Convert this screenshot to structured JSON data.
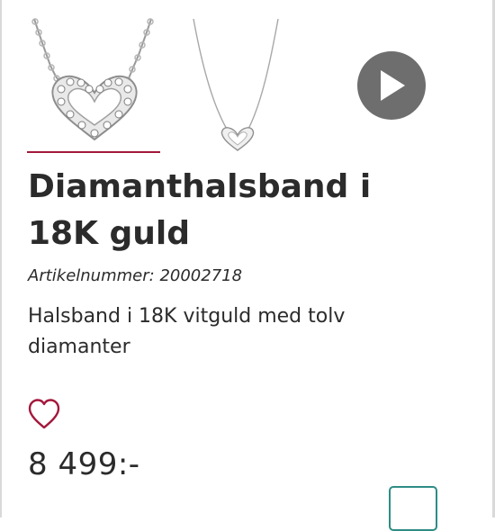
{
  "product": {
    "title": "Diamanthalsband i 18K guld",
    "sku_label": "Artikelnummer:",
    "sku_value": "20002718",
    "description": "Halsband i 18K vitguld med tolv diamanter",
    "price": "8 499:-"
  },
  "gallery": {
    "thumbnails": [
      {
        "icon": "heart-necklace-closeup-image",
        "selected": true
      },
      {
        "icon": "heart-necklace-full-image",
        "selected": false
      }
    ],
    "video_icon": "play-icon"
  },
  "actions": {
    "wishlist_icon": "heart-outline-icon",
    "cart_icon": "add-to-cart-button"
  },
  "colors": {
    "accent": "#a3183b",
    "video_button": "#6e6e6e",
    "cart_border": "#2e8c84",
    "text": "#2b2b2b"
  }
}
